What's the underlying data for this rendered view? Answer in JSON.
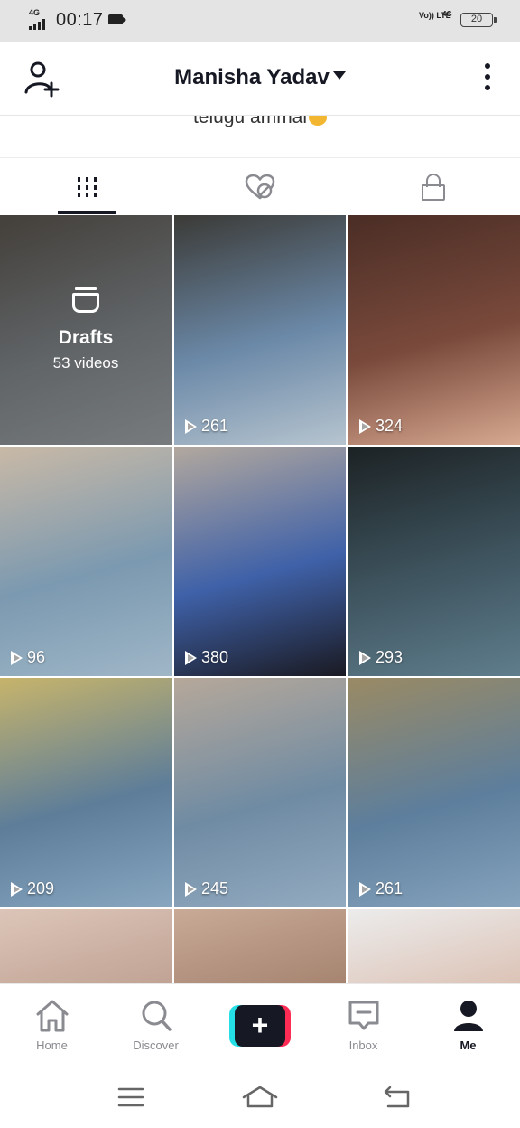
{
  "status_bar": {
    "network": "4G",
    "time": "00:17",
    "volte": "Vo)) LTE",
    "network_right": "4G",
    "battery": "20"
  },
  "header": {
    "title": "Manisha Yadav",
    "add_friend_icon": "person-add-icon",
    "more_icon": "more-vertical-icon"
  },
  "bio": {
    "text": "telugu ammai"
  },
  "tabs": [
    {
      "icon": "grid-icon",
      "active": true
    },
    {
      "icon": "liked-heart-icon",
      "active": false
    },
    {
      "icon": "lock-icon",
      "active": false
    }
  ],
  "drafts": {
    "title": "Drafts",
    "count_label": "53 videos"
  },
  "videos": [
    {
      "views": "261",
      "colors": [
        "#3b3a36",
        "#6b89a8",
        "#b6c4cf"
      ]
    },
    {
      "views": "324",
      "colors": [
        "#4a2d25",
        "#7a4a3c",
        "#d7a890"
      ]
    },
    {
      "views": "96",
      "colors": [
        "#c9b9a6",
        "#7b99b0",
        "#9fb6c7"
      ]
    },
    {
      "views": "380",
      "colors": [
        "#b2a89e",
        "#3f61a8",
        "#1a1a22"
      ]
    },
    {
      "views": "293",
      "colors": [
        "#1c2224",
        "#3f5560",
        "#5f7d8c"
      ]
    },
    {
      "views": "209",
      "colors": [
        "#c7b46b",
        "#5d7d99",
        "#88a6c0"
      ]
    },
    {
      "views": "245",
      "colors": [
        "#b6a89a",
        "#6f8ba3",
        "#93abc1"
      ]
    },
    {
      "views": "261",
      "colors": [
        "#9a8a64",
        "#5d7e9c",
        "#86a3bd"
      ]
    },
    {
      "views": "",
      "colors": [
        "#dcc5b8",
        "#b99a8b",
        "#8b6b5f"
      ]
    },
    {
      "views": "",
      "colors": [
        "#c8aa97",
        "#9d7a66",
        "#6e5244"
      ]
    },
    {
      "views": "",
      "colors": [
        "#ececec",
        "#d8b8a8",
        "#a87a66"
      ]
    }
  ],
  "bottom_nav": [
    {
      "label": "Home",
      "icon": "home-icon",
      "active": false
    },
    {
      "label": "Discover",
      "icon": "search-icon",
      "active": false
    },
    {
      "label": "",
      "icon": "plus-icon",
      "active": false
    },
    {
      "label": "Inbox",
      "icon": "inbox-icon",
      "active": false
    },
    {
      "label": "Me",
      "icon": "profile-icon",
      "active": true
    }
  ],
  "system_nav": [
    "menu-icon",
    "home-outline-icon",
    "back-icon"
  ],
  "colors": {
    "text_primary": "#161823",
    "text_secondary": "#8a8b91",
    "brand_cyan": "#24e0e6",
    "brand_pink": "#fe2c55"
  }
}
